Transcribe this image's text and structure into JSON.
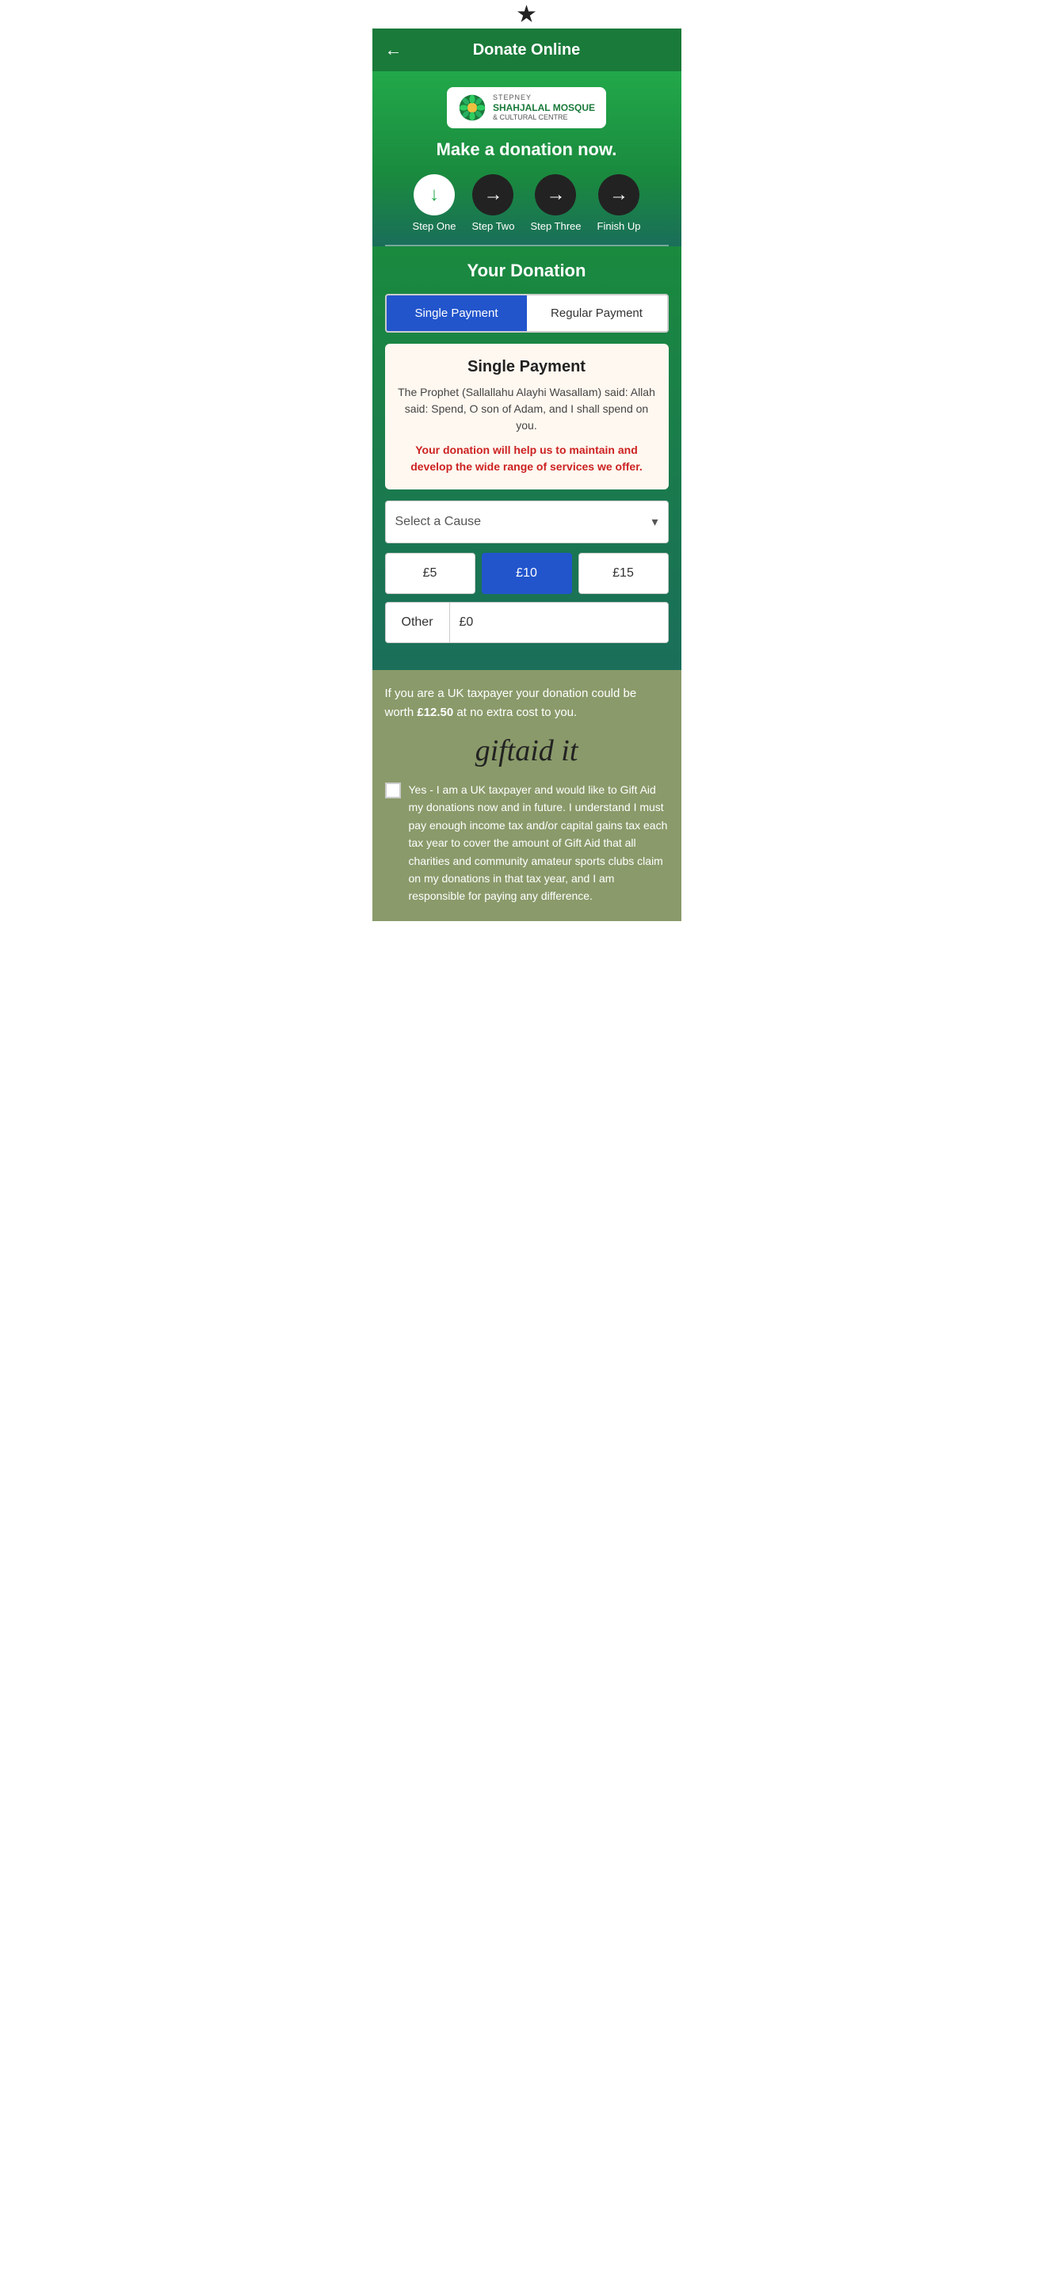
{
  "statusBar": {
    "icon": "signal-dot"
  },
  "header": {
    "back_label": "←",
    "title": "Donate Online"
  },
  "hero": {
    "logo": {
      "stepney": "STEPNEY",
      "name": "SHAHJALAL MOSQUE",
      "sub": "& CULTURAL CENTRE"
    },
    "title": "Make a donation now."
  },
  "steps": [
    {
      "label": "Step One",
      "icon": "↓",
      "active": true
    },
    {
      "label": "Step Two",
      "icon": "→",
      "active": false
    },
    {
      "label": "Step Three",
      "icon": "→",
      "active": false
    },
    {
      "label": "Finish Up",
      "icon": "→",
      "active": false
    }
  ],
  "donation": {
    "title": "Your Donation",
    "payment_types": [
      {
        "label": "Single Payment",
        "selected": true
      },
      {
        "label": "Regular Payment",
        "selected": false
      }
    ],
    "card": {
      "title": "Single Payment",
      "quote": "The Prophet (Sallallahu Alayhi Wasallam) said: Allah said: Spend, O son of Adam, and I shall spend on you.",
      "cta": "Your donation will help us to maintain and develop the wide range of services we offer."
    },
    "select_cause_placeholder": "Select a Cause",
    "amounts": [
      {
        "value": "£5",
        "selected": false
      },
      {
        "value": "£10",
        "selected": true
      },
      {
        "value": "£15",
        "selected": false
      }
    ],
    "other_label": "Other",
    "other_input_value": "£0"
  },
  "giftaid": {
    "text_prefix": "If you are a UK taxpayer your donation could be worth ",
    "amount": "£12.50",
    "text_suffix": " at no extra cost to you.",
    "logo_text": "giftaid it",
    "checkbox_label": "Yes - I am a UK taxpayer and would like to Gift Aid my donations now and in future. I understand I must pay enough income tax and/or capital gains tax each tax year to cover the amount of Gift Aid that all charities and community amateur sports clubs claim on my donations in that tax year, and I am responsible for paying any difference."
  }
}
